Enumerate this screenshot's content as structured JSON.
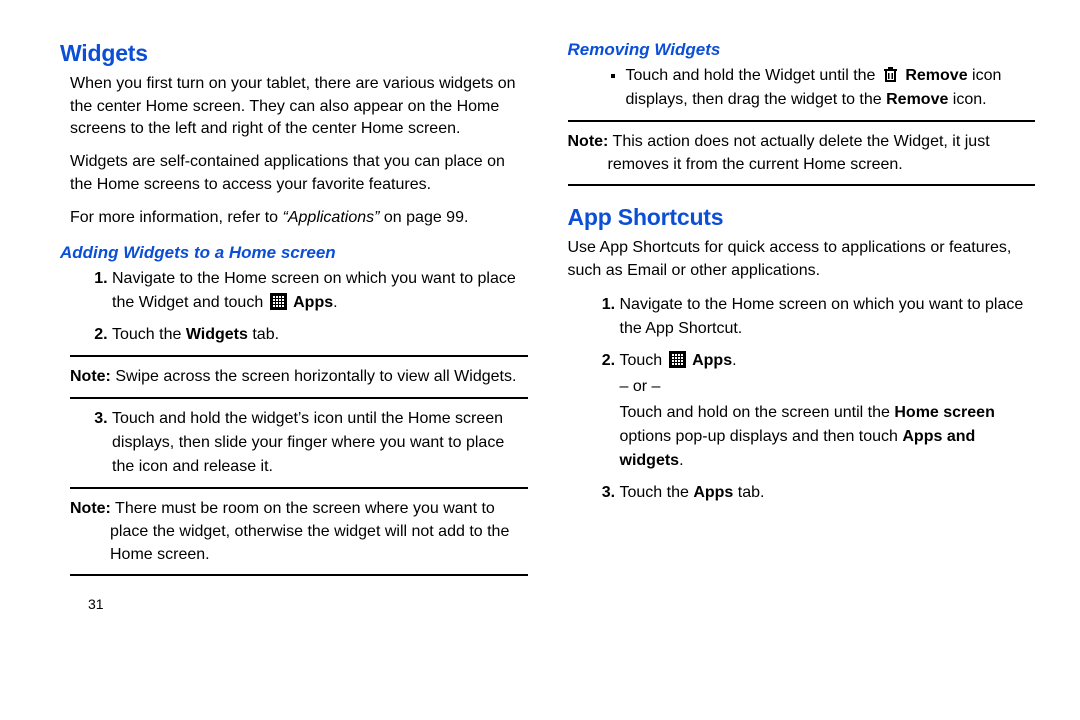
{
  "pageNumber": "31",
  "left": {
    "widgetsHeading": "Widgets",
    "intro1": "When you first turn on your tablet, there are various widgets on the center Home screen. They can also appear on the Home screens to the left and right of the center Home screen.",
    "intro2": "Widgets are self-contained applications that you can place on the Home screens to access your favorite features.",
    "moreInfoPrefix": "For more information, refer to ",
    "moreInfoItalic": "“Applications”",
    "moreInfoSuffix": " on page 99.",
    "addingHeading": "Adding Widgets to a Home screen",
    "step1a": "Navigate to the Home screen on which you want to place the Widget and touch ",
    "step1AppsLabel": "Apps",
    "step1dot": ".",
    "step2a": "Touch the ",
    "step2b": "Widgets",
    "step2c": " tab.",
    "note1Prefix": "Note:",
    "note1Text": " Swipe across the screen horizontally to view all Widgets.",
    "step3": "Touch and hold the widget’s icon until the Home screen displays, then slide your finger where you want to place the icon and release it.",
    "note2Prefix": "Note:",
    "note2Text": " There must be room on the screen where you want to place the widget, otherwise the widget will not add to the Home screen."
  },
  "right": {
    "removingHeading": "Removing Widgets",
    "rem1a": "Touch and hold the Widget until the ",
    "rem1b": "Remove",
    "rem1c": " icon displays, then drag the widget to the ",
    "rem1d": "Remove",
    "rem1e": " icon.",
    "noteRPrefix": "Note:",
    "noteRText": " This action does not actually delete the Widget, it just removes it from the current Home screen.",
    "appShortcutsHeading": "App Shortcuts",
    "appIntro": "Use App Shortcuts for quick access to applications or features, such as Email or other applications.",
    "s1": "Navigate to the Home screen on which you want to place the App Shortcut.",
    "s2a": "Touch ",
    "s2Apps": "Apps",
    "s2dot": ".",
    "or": "– or –",
    "s2b1": "Touch and hold on the screen until the ",
    "s2b2": "Home screen",
    "s2b3": " options pop-up displays and then touch ",
    "s2b4": "Apps and widgets",
    "s2b5": ".",
    "s3a": "Touch the ",
    "s3b": "Apps",
    "s3c": " tab."
  }
}
